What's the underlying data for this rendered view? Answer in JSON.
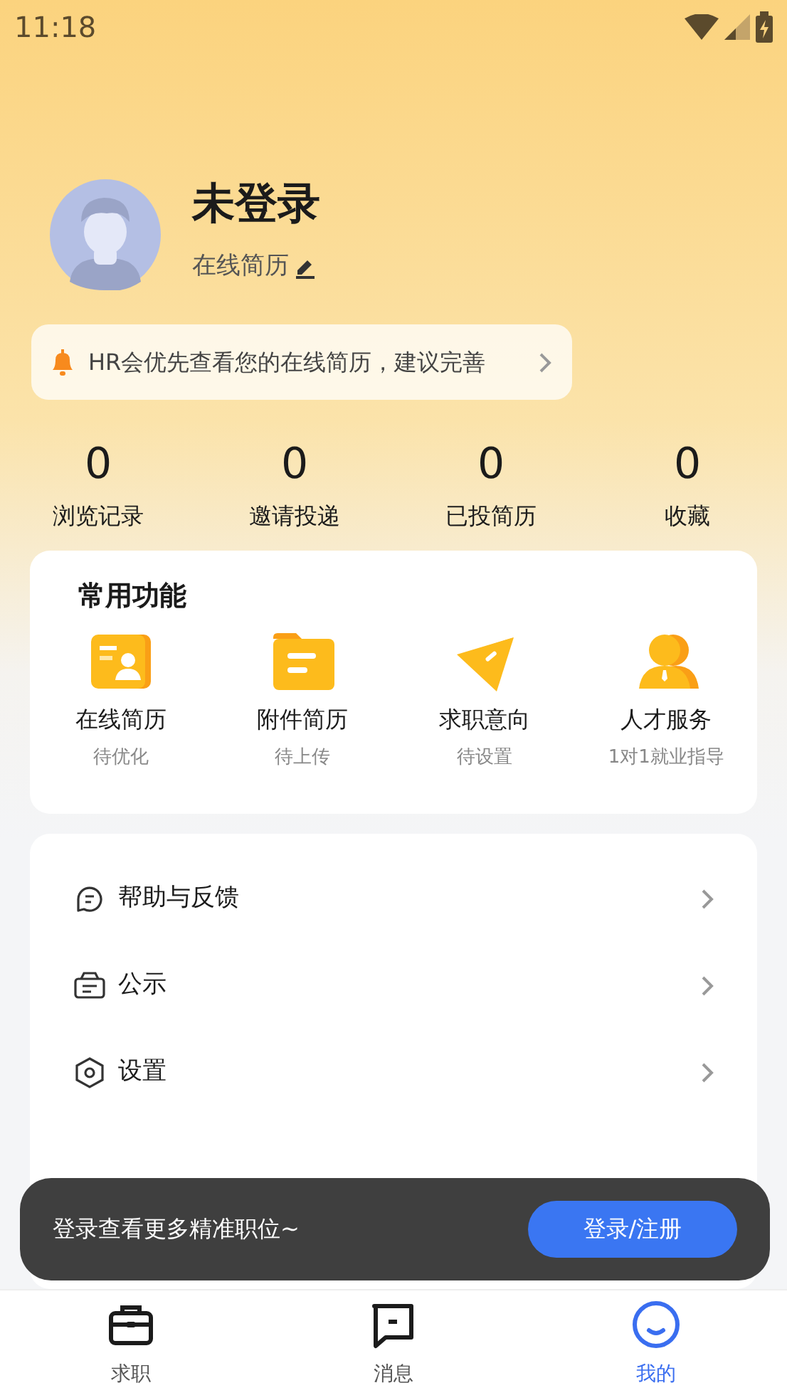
{
  "status_bar": {
    "time": "11:18"
  },
  "profile": {
    "name": "未登录",
    "resume_link": "在线简历"
  },
  "tip": {
    "text": "HR会优先查看您的在线简历，建议完善"
  },
  "stats": [
    {
      "value": "0",
      "label": "浏览记录"
    },
    {
      "value": "0",
      "label": "邀请投递"
    },
    {
      "value": "0",
      "label": "已投简历"
    },
    {
      "value": "0",
      "label": "收藏"
    }
  ],
  "functions": {
    "title": "常用功能",
    "items": [
      {
        "kind": "resume",
        "label": "在线简历",
        "status": "待优化"
      },
      {
        "kind": "folder",
        "label": "附件简历",
        "status": "待上传"
      },
      {
        "kind": "send",
        "label": "求职意向",
        "status": "待设置"
      },
      {
        "kind": "person",
        "label": "人才服务",
        "status": "1对1就业指导"
      }
    ]
  },
  "menu": [
    {
      "kind": "help",
      "label": "帮助与反馈"
    },
    {
      "kind": "notice",
      "label": "公示"
    },
    {
      "kind": "settings",
      "label": "设置"
    }
  ],
  "toast": {
    "text": "登录查看更多精准职位~",
    "button": "登录/注册"
  },
  "tab_bar": [
    {
      "kind": "briefcase",
      "label": "求职",
      "selected": false
    },
    {
      "kind": "message",
      "label": "消息",
      "selected": false
    },
    {
      "kind": "smile",
      "label": "我的",
      "selected": true
    }
  ]
}
